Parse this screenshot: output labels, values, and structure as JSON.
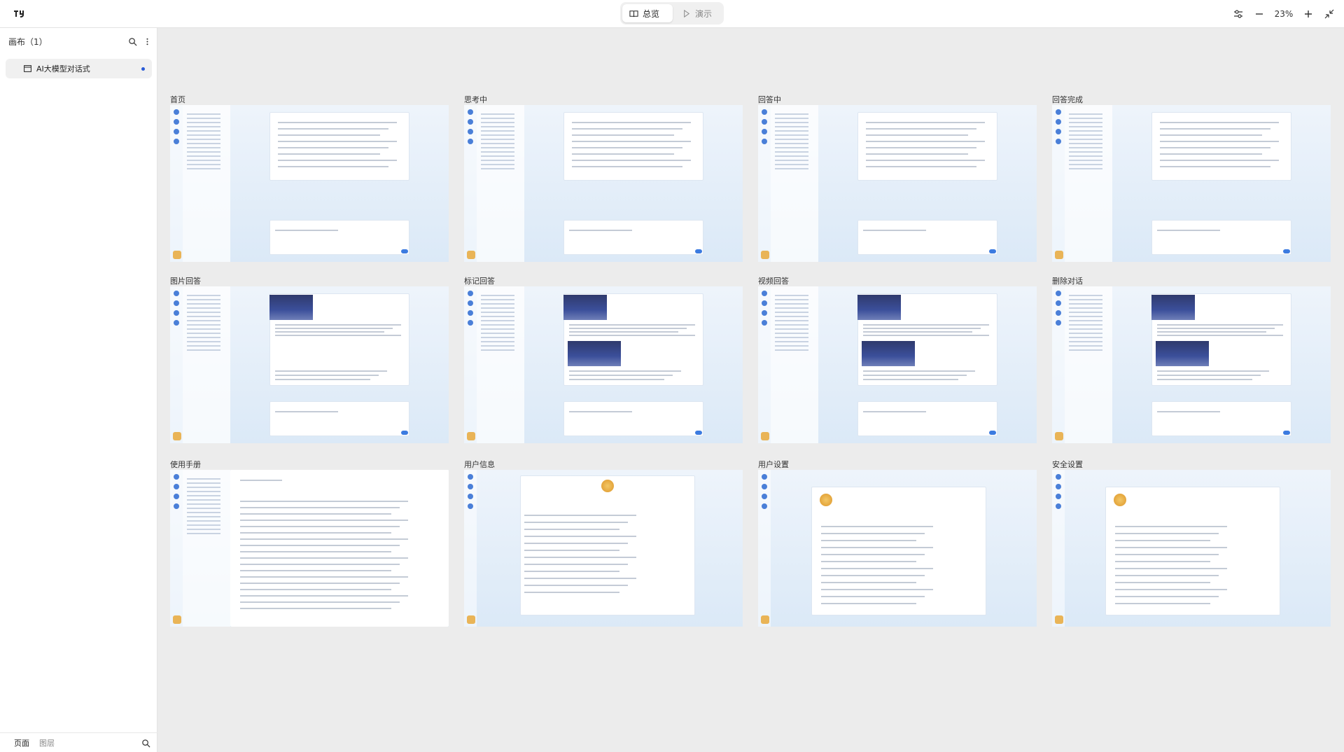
{
  "app": {
    "logo_icon": "app-logo-icon"
  },
  "topbar": {
    "modes": [
      {
        "label": "总览",
        "icon": "book-icon",
        "active": true
      },
      {
        "label": "演示",
        "icon": "play-icon",
        "active": false
      }
    ],
    "zoom": "23%"
  },
  "sidebar": {
    "title": "画布（1）",
    "items": [
      {
        "label": "AI大模型对话式",
        "icon": "page-icon",
        "selected": true
      }
    ],
    "footer_tabs": [
      "页面",
      "图层"
    ]
  },
  "canvas": {
    "frames": [
      {
        "title": "首页"
      },
      {
        "title": "思考中"
      },
      {
        "title": "回答中"
      },
      {
        "title": "回答完成"
      },
      {
        "title": "图片回答"
      },
      {
        "title": "标记回答"
      },
      {
        "title": "视频回答"
      },
      {
        "title": "删除对话"
      },
      {
        "title": "使用手册"
      },
      {
        "title": "用户信息"
      },
      {
        "title": "用户设置"
      },
      {
        "title": "安全设置"
      }
    ]
  },
  "colors": {
    "accent": "#2a5bd7",
    "canvas_bg": "#ececec"
  }
}
